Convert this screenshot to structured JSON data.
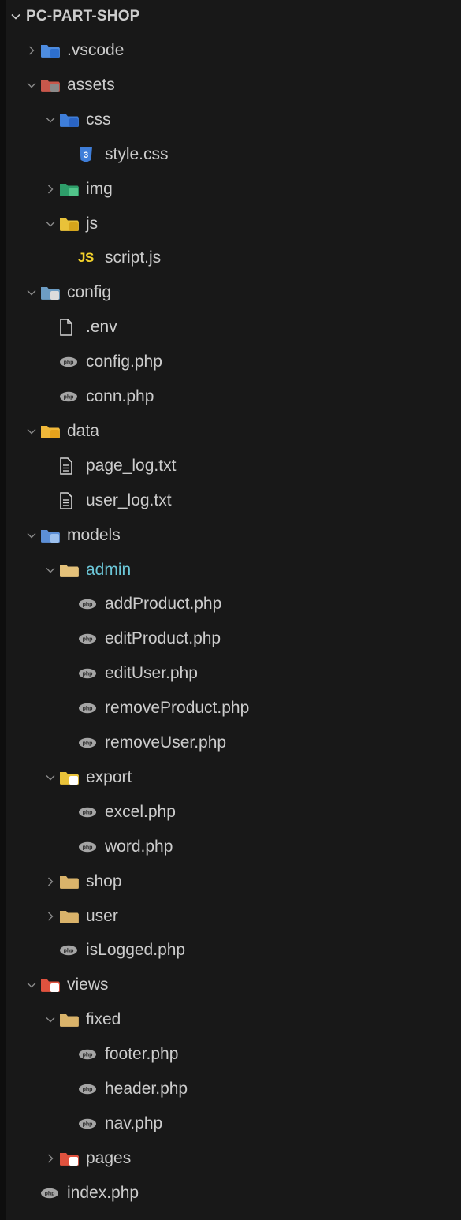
{
  "explorer": {
    "root_label": "PC-PART-SHOP",
    "items": [
      {
        "label": ".vscode",
        "depth": 1,
        "chevron": "right",
        "icon": "folder-vscode-icon",
        "icon_color": "#4e8ce0"
      },
      {
        "label": "assets",
        "depth": 1,
        "chevron": "down",
        "icon": "folder-assets-icon",
        "icon_color": "#c8584b"
      },
      {
        "label": "css",
        "depth": 2,
        "chevron": "down",
        "icon": "folder-css-icon",
        "icon_color": "#3f7ed9"
      },
      {
        "label": "style.css",
        "depth": 3,
        "chevron": "none",
        "icon": "css3-file-icon",
        "icon_color": "#3f7ed9"
      },
      {
        "label": "img",
        "depth": 2,
        "chevron": "right",
        "icon": "folder-images-icon",
        "icon_color": "#2e9e6a"
      },
      {
        "label": "js",
        "depth": 2,
        "chevron": "down",
        "icon": "folder-js-icon",
        "icon_color": "#e8c23a"
      },
      {
        "label": "script.js",
        "depth": 3,
        "chevron": "none",
        "icon": "js-file-icon",
        "icon_text": "JS",
        "icon_color": "#f3d22b"
      },
      {
        "label": "config",
        "depth": 1,
        "chevron": "down",
        "icon": "folder-config-icon",
        "icon_color": "#6d9dc4"
      },
      {
        "label": ".env",
        "depth": 2,
        "chevron": "none",
        "icon": "file-outline-icon",
        "icon_color": "#d4d4d4"
      },
      {
        "label": "config.php",
        "depth": 2,
        "chevron": "none",
        "icon": "php-file-icon",
        "icon_color": "#a5a5a5"
      },
      {
        "label": "conn.php",
        "depth": 2,
        "chevron": "none",
        "icon": "php-file-icon",
        "icon_color": "#a5a5a5"
      },
      {
        "label": "data",
        "depth": 1,
        "chevron": "down",
        "icon": "folder-database-icon",
        "icon_color": "#f0b83a"
      },
      {
        "label": "page_log.txt",
        "depth": 2,
        "chevron": "none",
        "icon": "text-file-icon",
        "icon_color": "#d4d4d4"
      },
      {
        "label": "user_log.txt",
        "depth": 2,
        "chevron": "none",
        "icon": "text-file-icon",
        "icon_color": "#d4d4d4"
      },
      {
        "label": "models",
        "depth": 1,
        "chevron": "down",
        "icon": "folder-models-icon",
        "icon_color": "#5d8fd6"
      },
      {
        "label": "admin",
        "depth": 2,
        "chevron": "down",
        "icon": "folder-admin-icon",
        "icon_color": "#e3c17a",
        "active": true
      },
      {
        "label": "addProduct.php",
        "depth": 3,
        "chevron": "none",
        "icon": "php-file-icon",
        "icon_color": "#a5a5a5"
      },
      {
        "label": "editProduct.php",
        "depth": 3,
        "chevron": "none",
        "icon": "php-file-icon",
        "icon_color": "#a5a5a5"
      },
      {
        "label": "editUser.php",
        "depth": 3,
        "chevron": "none",
        "icon": "php-file-icon",
        "icon_color": "#a5a5a5"
      },
      {
        "label": "removeProduct.php",
        "depth": 3,
        "chevron": "none",
        "icon": "php-file-icon",
        "icon_color": "#a5a5a5"
      },
      {
        "label": "removeUser.php",
        "depth": 3,
        "chevron": "none",
        "icon": "php-file-icon",
        "icon_color": "#a5a5a5"
      },
      {
        "label": "export",
        "depth": 2,
        "chevron": "down",
        "icon": "folder-export-icon",
        "icon_color": "#e8c23a"
      },
      {
        "label": "excel.php",
        "depth": 3,
        "chevron": "none",
        "icon": "php-file-icon",
        "icon_color": "#a5a5a5"
      },
      {
        "label": "word.php",
        "depth": 3,
        "chevron": "none",
        "icon": "php-file-icon",
        "icon_color": "#a5a5a5"
      },
      {
        "label": "shop",
        "depth": 2,
        "chevron": "right",
        "icon": "folder-icon",
        "icon_color": "#d9b36a"
      },
      {
        "label": "user",
        "depth": 2,
        "chevron": "right",
        "icon": "folder-icon",
        "icon_color": "#d9b36a"
      },
      {
        "label": "isLogged.php",
        "depth": 2,
        "chevron": "none",
        "icon": "php-file-icon",
        "icon_color": "#a5a5a5"
      },
      {
        "label": "views",
        "depth": 1,
        "chevron": "down",
        "icon": "folder-views-icon",
        "icon_color": "#e0523f"
      },
      {
        "label": "fixed",
        "depth": 2,
        "chevron": "down",
        "icon": "folder-icon",
        "icon_color": "#d9b36a"
      },
      {
        "label": "footer.php",
        "depth": 3,
        "chevron": "none",
        "icon": "php-file-icon",
        "icon_color": "#a5a5a5"
      },
      {
        "label": "header.php",
        "depth": 3,
        "chevron": "none",
        "icon": "php-file-icon",
        "icon_color": "#a5a5a5"
      },
      {
        "label": "nav.php",
        "depth": 3,
        "chevron": "none",
        "icon": "php-file-icon",
        "icon_color": "#a5a5a5"
      },
      {
        "label": "pages",
        "depth": 2,
        "chevron": "right",
        "icon": "folder-pages-icon",
        "icon_color": "#e0523f"
      },
      {
        "label": "index.php",
        "depth": 1,
        "chevron": "none",
        "icon": "php-file-icon",
        "icon_color": "#a5a5a5"
      }
    ]
  }
}
